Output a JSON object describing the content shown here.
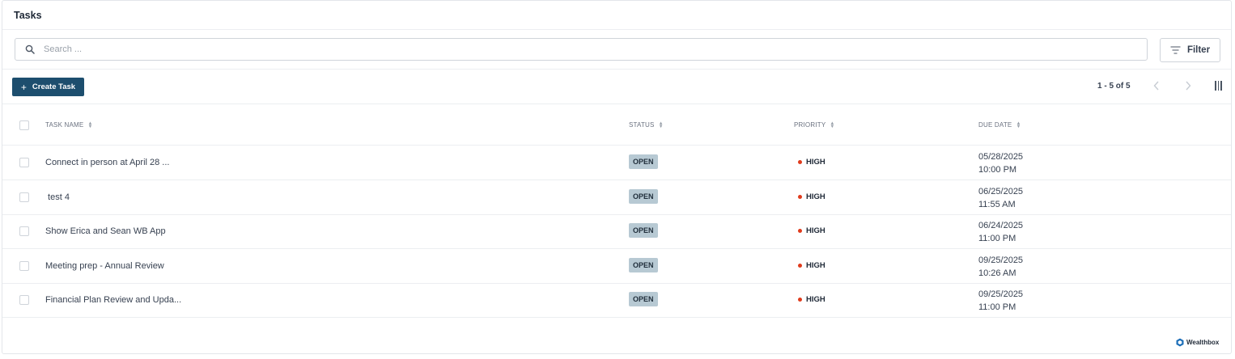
{
  "header": {
    "title": "Tasks"
  },
  "search": {
    "placeholder": "Search ..."
  },
  "toolbar": {
    "filter_label": "Filter",
    "create_label": "Create Task",
    "pagination": "1 - 5 of 5"
  },
  "table": {
    "columns": [
      "TASK NAME",
      "STATUS",
      "PRIORITY",
      "DUE DATE"
    ],
    "rows": [
      {
        "name": "Connect in person at April 28 ...",
        "status": "OPEN",
        "priority": "HIGH",
        "due_date": "05/28/2025",
        "due_time": "10:00 PM"
      },
      {
        "name": " test 4",
        "status": "OPEN",
        "priority": "HIGH",
        "due_date": "06/25/2025",
        "due_time": "11:55 AM"
      },
      {
        "name": "Show Erica and Sean WB App",
        "status": "OPEN",
        "priority": "HIGH",
        "due_date": "06/24/2025",
        "due_time": "11:00 PM"
      },
      {
        "name": "Meeting prep - Annual Review",
        "status": "OPEN",
        "priority": "HIGH",
        "due_date": "09/25/2025",
        "due_time": "10:26 AM"
      },
      {
        "name": "Financial Plan Review and Upda...",
        "status": "OPEN",
        "priority": "HIGH",
        "due_date": "09/25/2025",
        "due_time": "11:00 PM"
      }
    ]
  },
  "footer": {
    "brand": "Wealthbox"
  },
  "colors": {
    "primary": "#1d4e6e",
    "status_badge": "#b7c9d3",
    "priority_high": "#e03b1c"
  },
  "icons": {
    "search": "search-icon",
    "filter": "filter-icon",
    "plus": "plus-icon",
    "prev": "chevron-left-icon",
    "next": "chevron-right-icon",
    "columns": "columns-icon",
    "sort": "sort-icon"
  }
}
